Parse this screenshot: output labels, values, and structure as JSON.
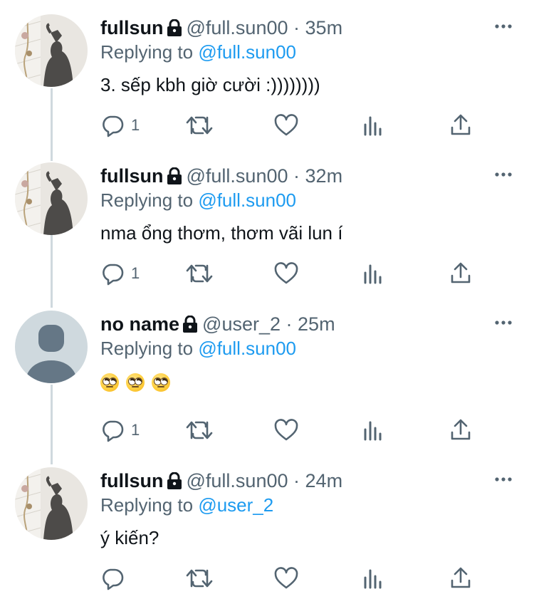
{
  "tweets": [
    {
      "name": "fullsun",
      "handle": "@full.sun00",
      "dot": "·",
      "time": "35m",
      "replying_prefix": "Replying to ",
      "replying_to": "@full.sun00",
      "text": "3. sếp kbh giờ cười :))))))))",
      "reply_count": "1",
      "avatar": "photo-avatar"
    },
    {
      "name": "fullsun",
      "handle": "@full.sun00",
      "dot": "·",
      "time": "32m",
      "replying_prefix": "Replying to ",
      "replying_to": "@full.sun00",
      "text": "nma ổng thơm, thơm vãi lun í",
      "reply_count": "1",
      "avatar": "photo-avatar"
    },
    {
      "name": "no name",
      "handle": "@user_2",
      "dot": "·",
      "time": "25m",
      "replying_prefix": "Replying to ",
      "replying_to": "@full.sun00",
      "emojis": [
        "face-with-rolling-eyes",
        "face-with-rolling-eyes",
        "face-with-rolling-eyes"
      ],
      "reply_count": "1",
      "avatar": "default-avatar"
    },
    {
      "name": "fullsun",
      "handle": "@full.sun00",
      "dot": "·",
      "time": "24m",
      "replying_prefix": "Replying to ",
      "replying_to": "@user_2",
      "text": "ý kiến?",
      "reply_count": "",
      "avatar": "photo-avatar"
    }
  ],
  "icons": {
    "reply": "reply-icon",
    "retweet": "retweet-icon",
    "like": "heart-icon",
    "views": "analytics-icon",
    "share": "share-icon",
    "more": "more-icon",
    "lock": "lock-icon"
  },
  "colors": {
    "link": "#1d9bf0",
    "secondary": "#536471",
    "thread_line": "#cfd9de"
  }
}
